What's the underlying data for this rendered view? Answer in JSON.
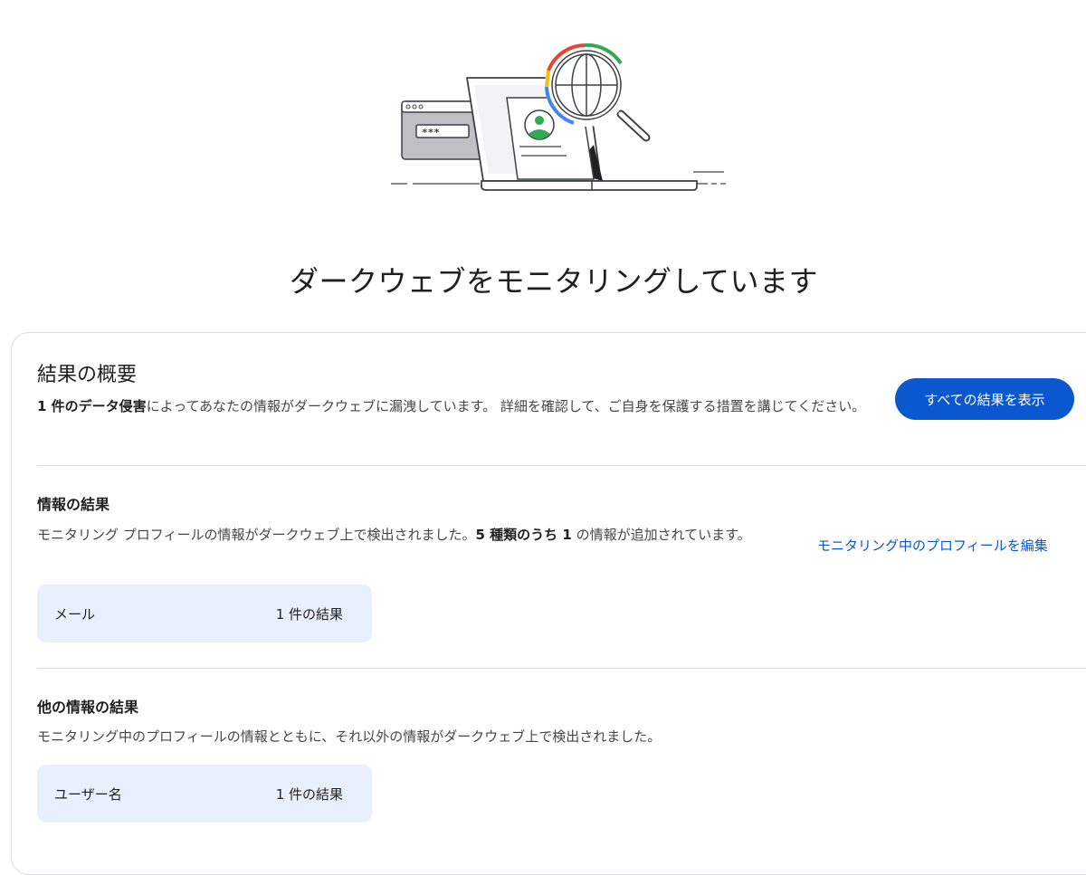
{
  "header": {
    "title": "ダークウェブをモニタリングしています",
    "illustration_password_mask": "***"
  },
  "summary": {
    "title": "結果の概要",
    "desc_bold": "1 件のデータ侵害",
    "desc_rest": "によってあなたの情報がダークウェブに漏洩しています。 詳細を確認して、ご自身を保護する措置を講じてください。",
    "view_all_button": "すべての結果を表示"
  },
  "info_results": {
    "title": "情報の結果",
    "desc_part1": "モニタリング プロフィールの情報がダークウェブ上で検出されました。",
    "desc_bold": "5 種類のうち 1",
    "desc_part2": " の情報が追加されています。",
    "edit_link": "モニタリング中のプロフィールを編集",
    "items": [
      {
        "label": "メール",
        "count": "1 件の結果"
      }
    ]
  },
  "other_results": {
    "title": "他の情報の結果",
    "desc": "モニタリング中のプロフィールの情報とともに、それ以外の情報がダークウェブ上で検出されました。",
    "items": [
      {
        "label": "ユーザー名",
        "count": "1 件の結果"
      }
    ]
  },
  "colors": {
    "primary": "#0b57d0",
    "tile_bg": "#e8f0fe",
    "google_blue": "#4285f4",
    "google_red": "#ea4335",
    "google_yellow": "#fbbc04",
    "google_green": "#34a853"
  }
}
